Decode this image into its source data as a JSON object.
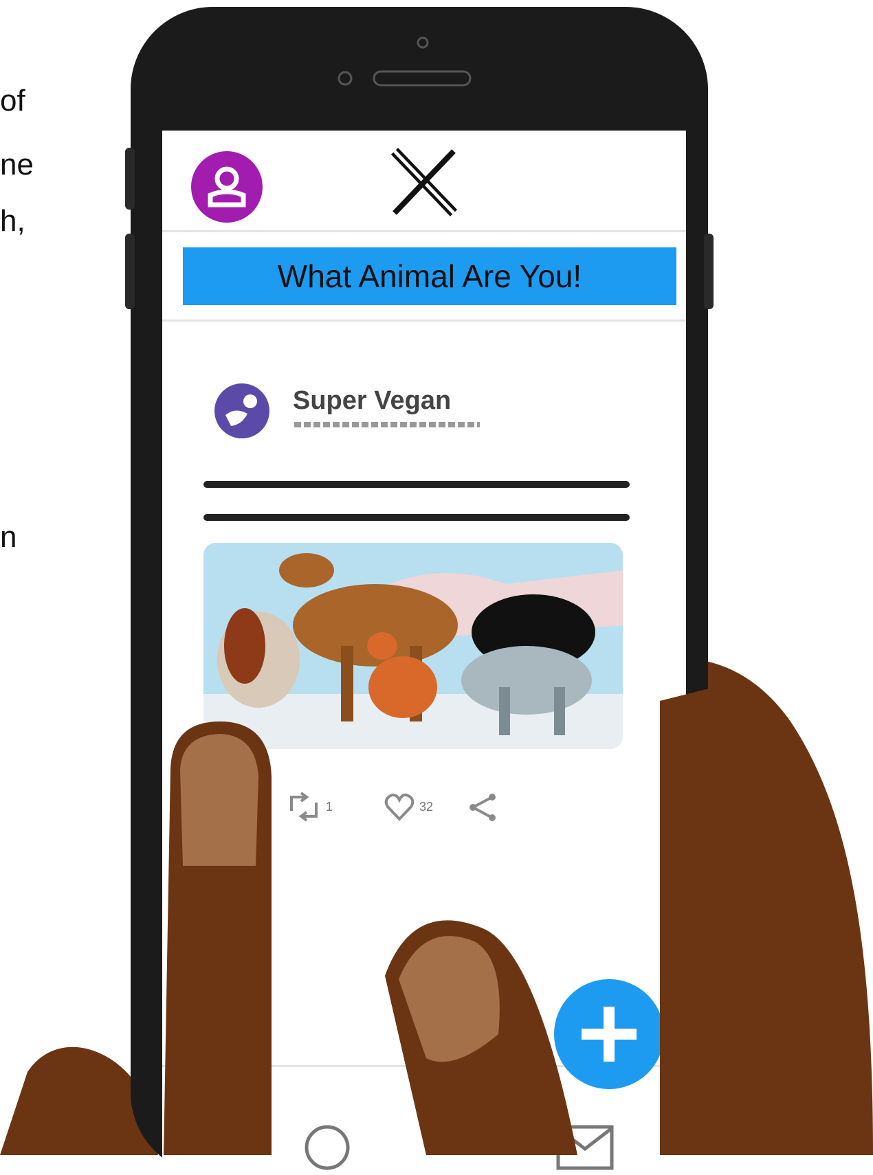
{
  "side_text": {
    "line1": "of",
    "line2": "ne",
    "line3": "h,",
    "line4": "n"
  },
  "app": {
    "logo": "x-logo",
    "banner_text": "What Animal Are You!",
    "accent_color": "#1d9bf0",
    "profile_color": "#a21caf"
  },
  "post": {
    "author_name": "Super Vegan",
    "image": "dogs-illustration",
    "retweet_count": "1",
    "like_count": "32"
  },
  "nav": {
    "items": [
      "search-icon",
      "mail-icon"
    ]
  },
  "compose_button": "plus-icon"
}
